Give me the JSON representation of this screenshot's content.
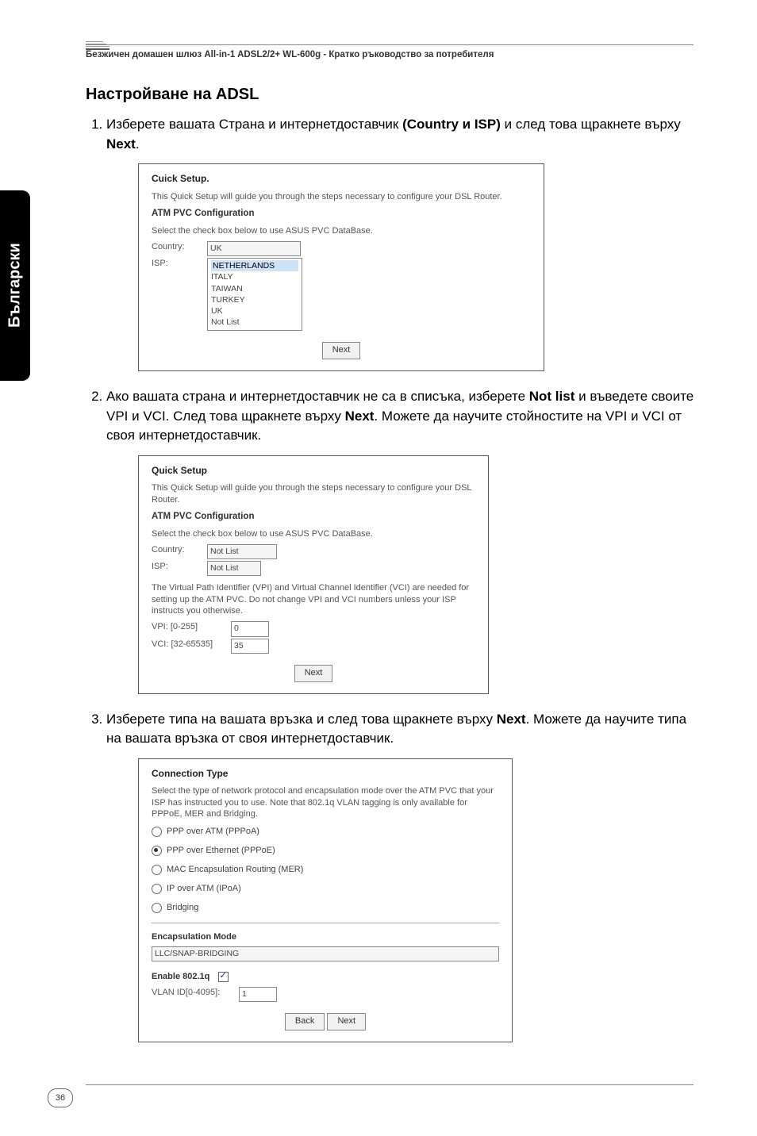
{
  "header": "Безжичен домашен шлюз All-in-1 ADSL2/2+ WL-600g - Кратко ръководство за потребителя",
  "side_tab": "Български",
  "section_title": "Настройване на ADSL",
  "steps": [
    {
      "num_text": "Изберете вашата Страна и интернетдоставчик (Country и ISP) и след това щракнете върху Next.",
      "bold_parts": [
        "(Country и ISP)",
        "Next"
      ]
    },
    {
      "num_text": "Ако вашата страна и интернетдоставчик не са в списъка, изберете Not list и въведете своите VPI и VCI. След това щракнете върху Next. Можете да научите стойностите на VPI и VCI от своя интернетдоставчик.",
      "bold_parts": [
        "Not list",
        "Next"
      ]
    },
    {
      "num_text": "Изберете типа на вашата връзка и след това щракнете върху Next. Можете да научите типа на вашата връзка от своя интернетдоставчик.",
      "bold_parts": [
        "Next"
      ]
    }
  ],
  "screenshot1": {
    "title": "Cuick Setup.",
    "desc": "This Quick Setup will guide you through the steps necessary to configure your DSL Router.",
    "subtitle": "ATM PVC Configuration",
    "desc2": "Select the check box below to use ASUS PVC DataBase.",
    "country_label": "Country:",
    "isp_label": "ISP:",
    "country_value": "UK",
    "isp_list": [
      "NETHERLANDS",
      "ITALY",
      "TAIWAN",
      "TURKEY",
      "UK",
      "Not List"
    ],
    "next_btn": "Next"
  },
  "screenshot2": {
    "title": "Quick Setup",
    "desc": "This Quick Setup will guide you through the steps necessary to configure your DSL Router.",
    "subtitle": "ATM PVC Configuration",
    "desc2": "Select the check box below to use ASUS PVC DataBase.",
    "country_label": "Country:",
    "isp_label": "ISP:",
    "country_value": "Not List",
    "isp_value": "Not List",
    "desc3": "The Virtual Path Identifier (VPI) and Virtual Channel Identifier (VCI) are needed for setting up the ATM PVC. Do not change VPI and VCI numbers unless your ISP instructs you otherwise.",
    "vpi_label": "VPI: [0-255]",
    "vpi_value": "0",
    "vci_label": "VCI: [32-65535]",
    "vci_value": "35",
    "next_btn": "Next"
  },
  "screenshot3": {
    "title": "Connection Type",
    "desc": "Select the type of network protocol and encapsulation mode over the ATM PVC that your ISP has instructed you to use. Note that 802.1q VLAN tagging is only available for PPPoE, MER and Bridging.",
    "options": [
      {
        "label": "PPP over ATM (PPPoA)",
        "checked": false
      },
      {
        "label": "PPP over Ethernet (PPPoE)",
        "checked": true
      },
      {
        "label": "MAC Encapsulation Routing (MER)",
        "checked": false
      },
      {
        "label": "IP over ATM (IPoA)",
        "checked": false
      },
      {
        "label": "Bridging",
        "checked": false
      }
    ],
    "encap_label": "Encapsulation Mode",
    "encap_value": "LLC/SNAP-BRIDGING",
    "enable_label": "Enable 802.1q",
    "vlan_label": "VLAN ID[0-4095]:",
    "vlan_value": "1",
    "back_btn": "Back",
    "next_btn": "Next"
  },
  "page_number": "36"
}
